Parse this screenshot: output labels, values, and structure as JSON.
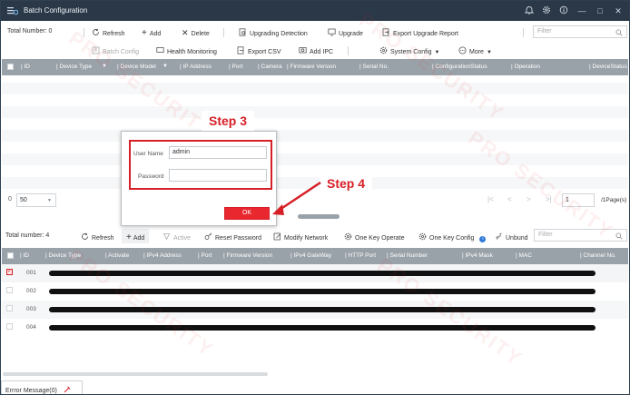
{
  "window": {
    "title": "Batch Configuration",
    "controls": {
      "minimize": "—",
      "maximize": "□",
      "close": "✕"
    }
  },
  "top_toolbar": {
    "total_label": "Total Number: 0",
    "items": [
      "Refresh",
      "Add",
      "Delete",
      "Upgrading Detection",
      "Upgrade",
      "Export Upgrade Report"
    ],
    "filter_placeholder": "Filter"
  },
  "second_toolbar": {
    "items": [
      "Batch Config",
      "Health Monitoring",
      "Export CSV",
      "Add IPC",
      "System Config",
      "More"
    ]
  },
  "top_table": {
    "columns": [
      "ID",
      "Device Type",
      "Device Model",
      "IP Address",
      "Port",
      "Camera",
      "Firmware Version",
      "Serial No.",
      "ConfigurationStatus",
      "Operation",
      "DeviceStatus"
    ]
  },
  "pager": {
    "page_size": "50",
    "page_input": "1",
    "page_total": "/1Page(s)"
  },
  "device_toolbar": {
    "total_label": "Total number: 4",
    "items": [
      "Refresh",
      "Add",
      "Active",
      "Reset Password",
      "Modify Network",
      "One Key Operate",
      "One Key Config",
      "Unbund"
    ],
    "filter_placeholder": "Filter"
  },
  "device_table": {
    "columns": [
      "ID",
      "Device Type",
      "Activate",
      "IPv4 Address",
      "Port",
      "Firmware Version",
      "IPv4 GateWay",
      "HTTP Port",
      "Serial Number",
      "IPv4 Mask",
      "MAC",
      "Channel No."
    ],
    "rows": [
      {
        "id": "001",
        "checked": true
      },
      {
        "id": "002",
        "checked": false
      },
      {
        "id": "003",
        "checked": false
      },
      {
        "id": "004",
        "checked": false
      }
    ]
  },
  "bottom_tab": {
    "label": "Errror Message(0)"
  },
  "login_dialog": {
    "username_label": "User Name",
    "username_value": "admin",
    "password_label": "Password",
    "password_value": "",
    "ok_label": "OK"
  },
  "annotations": {
    "step3": "Step 3",
    "step4": "Step 4"
  },
  "watermark": "PRO SECURITY",
  "colors": {
    "titlebar": "#2a3848",
    "header": "#9aa2a9",
    "accent_red": "#d61f26",
    "ok_button": "#e8282e"
  }
}
